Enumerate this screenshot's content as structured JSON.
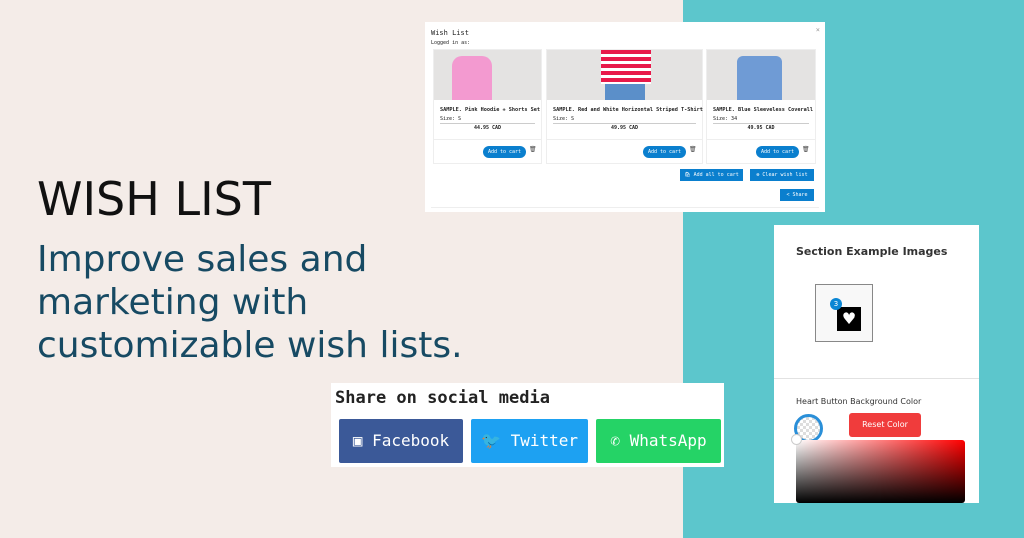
{
  "hero": {
    "title": "WISH LIST",
    "subtitle": "Improve sales and marketing with customizable wish lists."
  },
  "wishlist": {
    "title": "Wish List",
    "logged_in": "Logged in as:",
    "close": "×",
    "items": [
      {
        "name": "SAMPLE. Pink Hoodie + Shorts Set",
        "size": "Size: S",
        "price": "44.95 CAD",
        "add": "Add to cart"
      },
      {
        "name": "SAMPLE. Red and White Horizontal Striped T-Shirt",
        "size": "Size: S",
        "price": "49.95 CAD",
        "add": "Add to cart"
      },
      {
        "name": "SAMPLE. Blue Sleeveless Coverall",
        "size": "Size: 34",
        "price": "49.95 CAD",
        "add": "Add to cart"
      }
    ],
    "add_all": "🛍 Add all to cart",
    "clear": "⊗ Clear wish list",
    "share": "< Share"
  },
  "settings": {
    "section_title": "Section Example Images",
    "badge_count": "3",
    "color_label": "Heart Button Background Color",
    "reset": "Reset Color",
    "accent": "#f03c3c"
  },
  "share": {
    "title": "Share on social media",
    "buttons": [
      {
        "label": "Facebook",
        "color": "#3b5998"
      },
      {
        "label": "Twitter",
        "color": "#1da1f2"
      },
      {
        "label": "WhatsApp",
        "color": "#25d366"
      }
    ]
  }
}
